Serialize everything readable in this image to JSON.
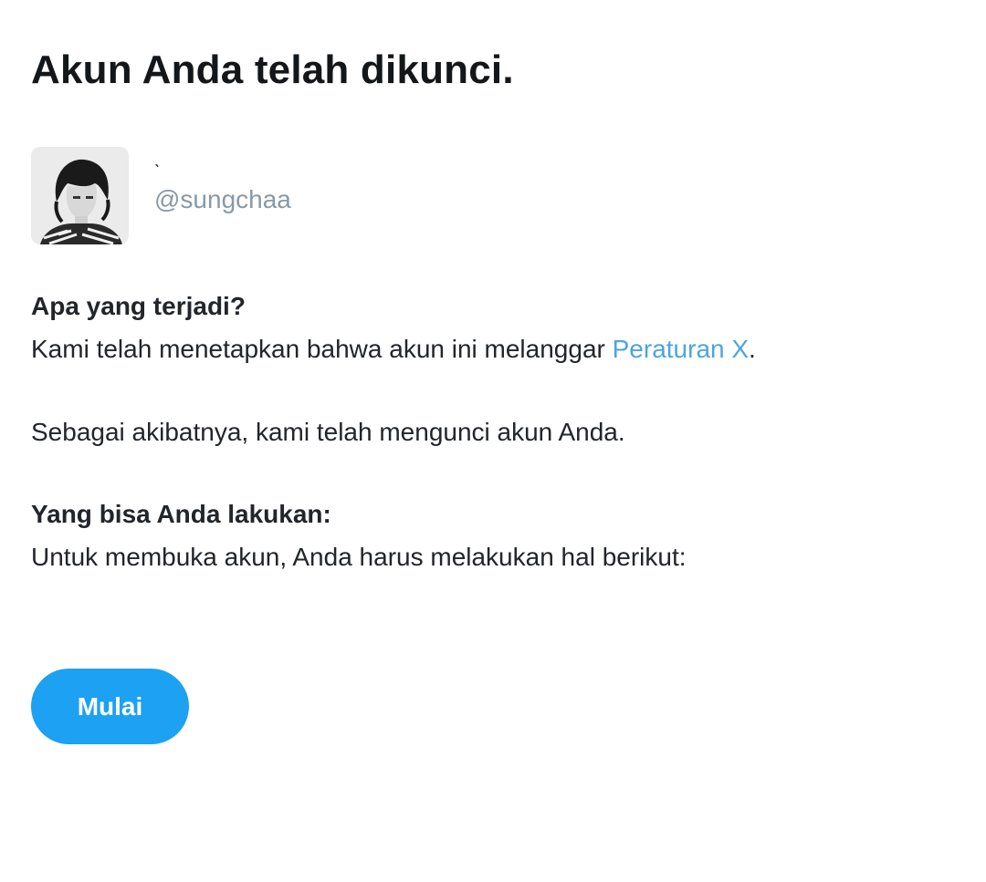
{
  "header": {
    "title": "Akun Anda telah dikunci."
  },
  "profile": {
    "display_name": "ˎ",
    "handle": "@sungchaa"
  },
  "what_happened": {
    "heading": "Apa yang terjadi?",
    "text_before_link": "Kami telah menetapkan bahwa akun ini melanggar ",
    "link_label": "Peraturan X",
    "text_after_link": ".",
    "consequence": "Sebagai akibatnya, kami telah mengunci akun Anda."
  },
  "what_you_can_do": {
    "heading": "Yang bisa Anda lakukan:",
    "text": "Untuk membuka akun, Anda harus melakukan hal berikut:"
  },
  "actions": {
    "start_label": "Mulai"
  },
  "colors": {
    "link": "#4ca5e0",
    "button": "#1da1f2",
    "handle": "#8899a6"
  }
}
